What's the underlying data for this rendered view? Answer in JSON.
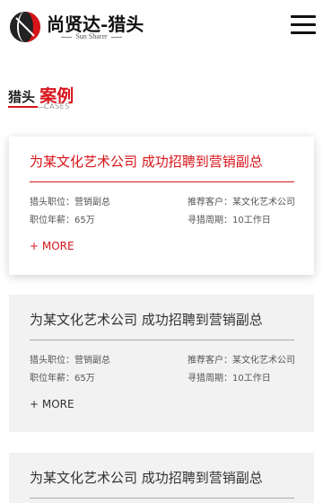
{
  "header": {
    "logo_cn": "尚贤达-猎头",
    "logo_en": "Sun Sharer",
    "menu_icon": "hamburger-menu-icon"
  },
  "section": {
    "title_prefix": "猎头",
    "title_accent": "案例",
    "subtitle": "CASES",
    "accent_color": "#d7141a"
  },
  "cases": [
    {
      "title": "为某文化艺术公司 成功招聘到营销副总",
      "position": "猎头职位：营销副总",
      "client": "推荐客户：某文化艺术公司",
      "salary": "职位年薪：65万",
      "cycle": "寻猎周期：10工作日",
      "more": "+ MORE"
    },
    {
      "title": "为某文化艺术公司 成功招聘到营销副总",
      "position": "猎头职位：营销副总",
      "client": "推荐客户：某文化艺术公司",
      "salary": "职位年薪：65万",
      "cycle": "寻猎周期：10工作日",
      "more": "+ MORE"
    },
    {
      "title": "为某文化艺术公司 成功招聘到营销副总"
    }
  ]
}
